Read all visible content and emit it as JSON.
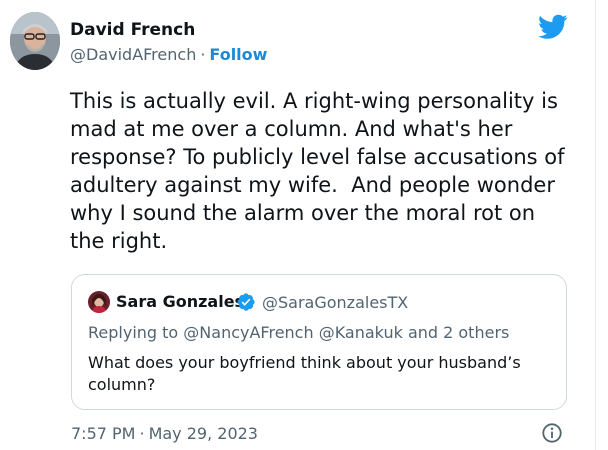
{
  "author": {
    "name": "David French",
    "handle": "@DavidAFrench",
    "separator": "·",
    "follow_label": "Follow"
  },
  "tweet": {
    "lines": [
      "This is actually evil. A right-wing personality is",
      "mad at me over a column. And what's her",
      "response? To publicly level false accusations of",
      "adultery against my wife.  And people wonder",
      "why I sound the alarm over the moral rot on",
      "the right."
    ]
  },
  "quote": {
    "name": "Sara Gonzales",
    "handle": "@SaraGonzalesTX",
    "reply_prefix": "Replying to",
    "mention_1": "@NancyAFrench",
    "mention_2": "@Kanakuk",
    "reply_suffix": "and 2 others",
    "text_lines": [
      "What does your boyfriend think about your husband’s",
      "column?"
    ]
  },
  "footer": {
    "time": "7:57 PM",
    "separator": "·",
    "date": "May 29, 2023"
  },
  "icons": {
    "brand": "twitter-bird-icon",
    "verified": "verified-badge-icon",
    "info": "info-icon"
  },
  "colors": {
    "brand": "#1d9bf0",
    "follow_link": "#1d8ad8",
    "secondary_text": "#536471",
    "primary_text": "#0f1419",
    "quote_border": "#cfd9de"
  }
}
